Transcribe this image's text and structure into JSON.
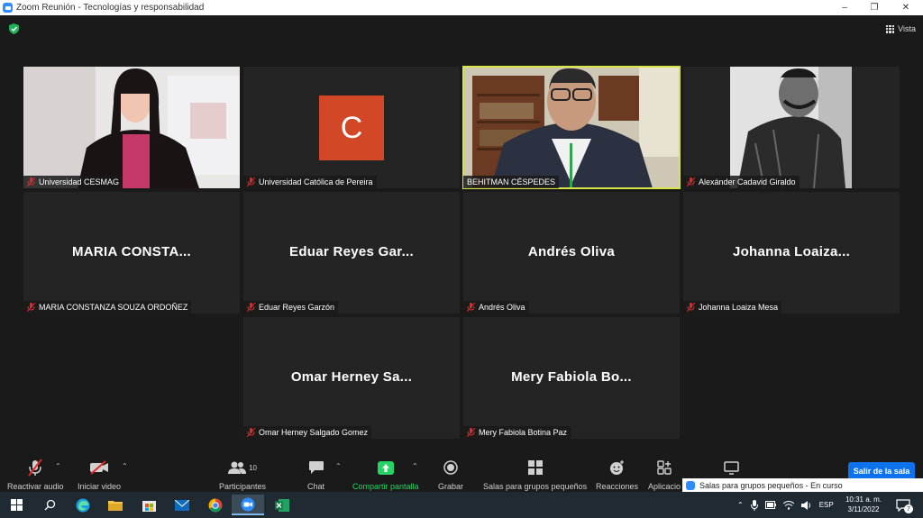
{
  "window": {
    "title": "Zoom Reunión - Tecnologías y responsabilidad",
    "minimize": "–",
    "maximize": "❐",
    "close": "✕"
  },
  "view_button": {
    "label": "Vista",
    "icon": "grid-icon"
  },
  "participants": [
    {
      "name": "Universidad CESMAG",
      "type": "video",
      "muted": true
    },
    {
      "name": "Universidad Católica de Pereira",
      "type": "avatar",
      "initial": "C",
      "avatar_color": "#d24726",
      "muted": true
    },
    {
      "name": "BEHITMAN CÉSPEDES",
      "type": "video",
      "speaking": true,
      "muted": false
    },
    {
      "name": "Alexánder Cadavid Giraldo",
      "type": "video",
      "muted": true
    },
    {
      "name": "MARIA CONSTANZA SOUZA ORDOÑEZ",
      "display": "MARIA  CONSTA...",
      "type": "name",
      "muted": true
    },
    {
      "name": "Eduar Reyes Garzón",
      "display": "Eduar Reyes Gar...",
      "type": "name",
      "muted": true
    },
    {
      "name": "Andrés Oliva",
      "display": "Andrés Oliva",
      "type": "name",
      "muted": true
    },
    {
      "name": "Johanna Loaiza Mesa",
      "display": "Johanna  Loaiza...",
      "type": "name",
      "muted": true
    },
    {
      "name": "Omar Herney Salgado Gomez",
      "display": "Omar Herney Sa...",
      "type": "name",
      "muted": true
    },
    {
      "name": "Mery Fabiola Botina Paz",
      "display": "Mery Fabiola Bo...",
      "type": "name",
      "muted": true
    }
  ],
  "toolbar": {
    "audio": "Reactivar audio",
    "video": "Iniciar video",
    "participants": "Participantes",
    "participants_count": "10",
    "chat": "Chat",
    "share": "Compartir pantalla",
    "record": "Grabar",
    "breakout": "Salas para grupos pequeños",
    "reactions": "Reacciones",
    "apps": "Aplicacio",
    "leave": "Salir de la sala"
  },
  "notification": {
    "text": "Salas para grupos pequeños - En curso"
  },
  "taskbar": {
    "language": "ESP",
    "time": "10:31 a. m.",
    "date": "3/11/2022",
    "notif_count": "7"
  },
  "colors": {
    "speaker_border": "#d7e646",
    "accent": "#0e72ed",
    "share_green": "#25d366"
  }
}
